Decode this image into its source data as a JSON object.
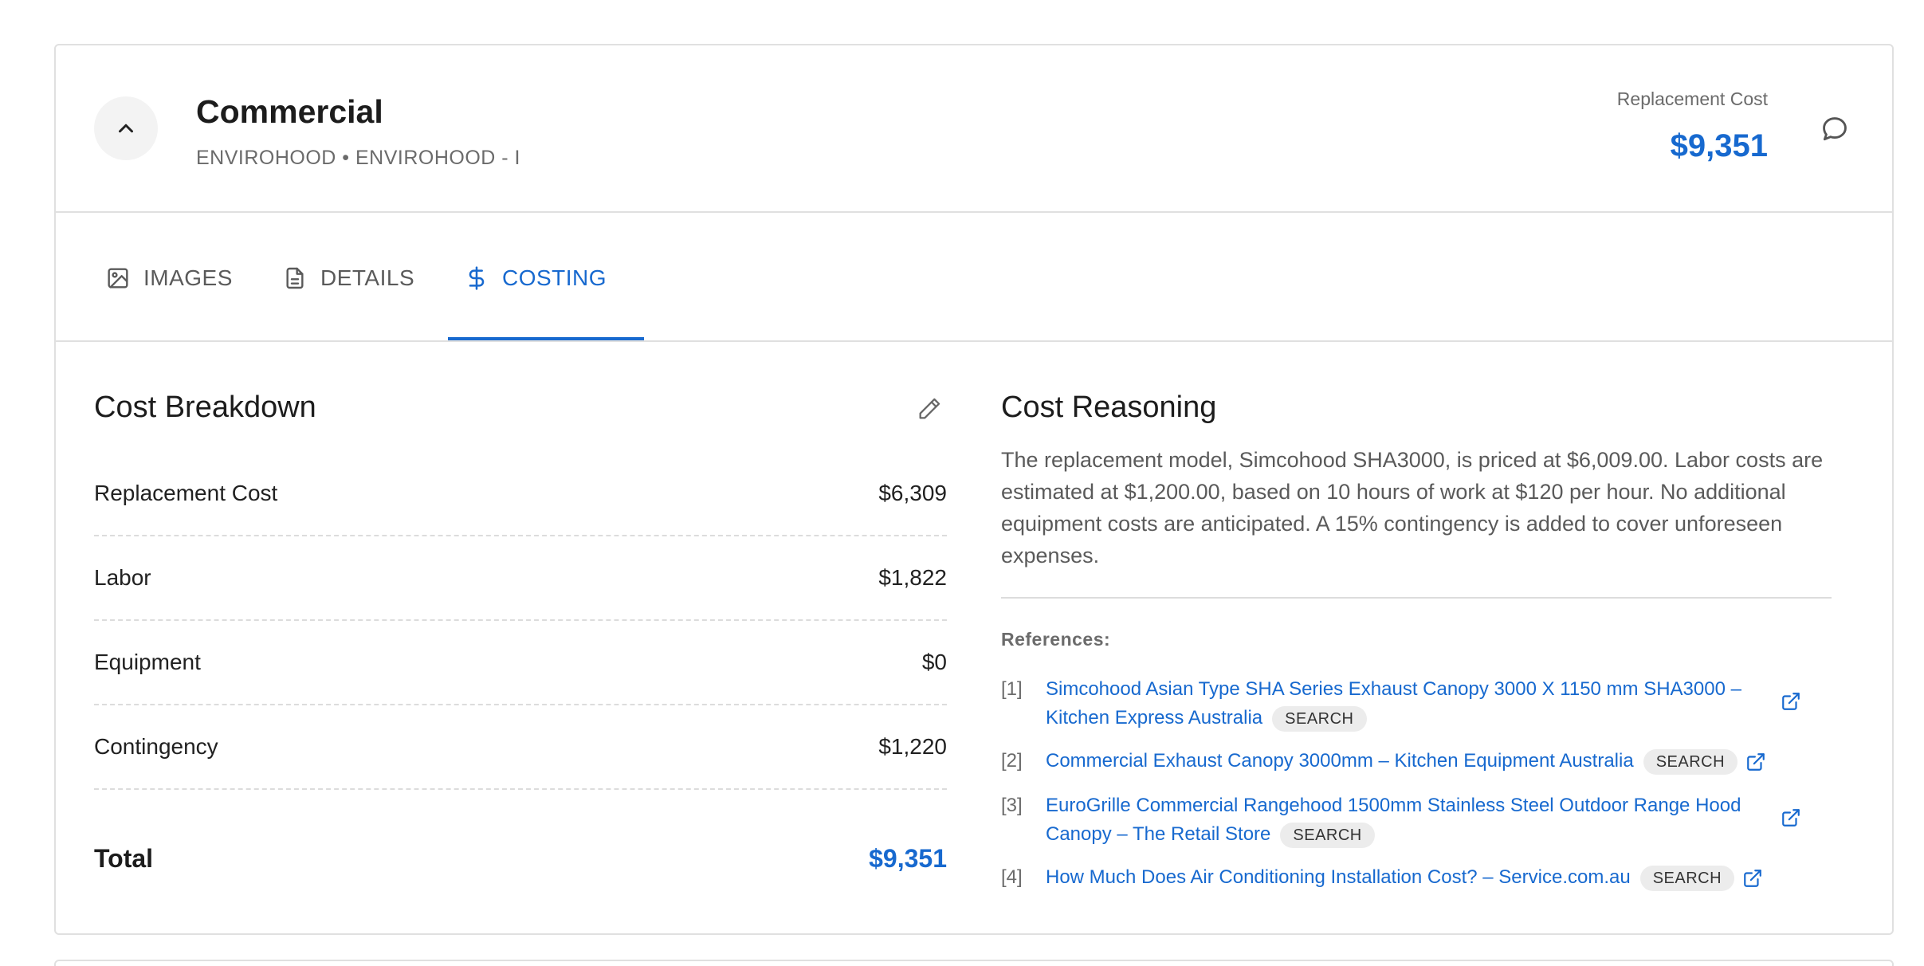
{
  "header": {
    "title": "Commercial",
    "subtitle": "ENVIROHOOD • ENVIROHOOD - I",
    "replacement_label": "Replacement Cost",
    "replacement_value": "$9,351",
    "collapse_icon": "chevron-up-icon",
    "comment_icon": "comment-icon"
  },
  "tabs": [
    {
      "label": "IMAGES",
      "icon": "image-icon",
      "active": false
    },
    {
      "label": "DETAILS",
      "icon": "document-icon",
      "active": false
    },
    {
      "label": "COSTING",
      "icon": "dollar-icon",
      "active": true
    }
  ],
  "breakdown": {
    "title": "Cost Breakdown",
    "rows": [
      {
        "label": "Replacement Cost",
        "value": "$6,309"
      },
      {
        "label": "Labor",
        "value": "$1,822"
      },
      {
        "label": "Equipment",
        "value": "$0"
      },
      {
        "label": "Contingency",
        "value": "$1,220"
      }
    ],
    "total_label": "Total",
    "total_value": "$9,351"
  },
  "reasoning": {
    "title": "Cost Reasoning",
    "text": "The replacement model, Simcohood SHA3000, is priced at $6,009.00. Labor costs are estimated at $1,200.00, based on 10 hours of work at $120 per hour. No additional equipment costs are anticipated. A 15% contingency is added to cover unforeseen expenses.",
    "references_label": "References:",
    "references": [
      {
        "num": "[1]",
        "text": "Simcohood Asian Type SHA Series Exhaust Canopy 3000 X 1150 mm SHA3000 – Kitchen Express Australia",
        "badge": "SEARCH"
      },
      {
        "num": "[2]",
        "text": "Commercial Exhaust Canopy 3000mm – Kitchen Equipment Australia",
        "badge": "SEARCH"
      },
      {
        "num": "[3]",
        "text": "EuroGrille Commercial Rangehood 1500mm Stainless Steel Outdoor Range Hood Canopy – The Retail Store",
        "badge": "SEARCH"
      },
      {
        "num": "[4]",
        "text": "How Much Does Air Conditioning Installation Cost? – Service.com.au",
        "badge": "SEARCH"
      }
    ]
  },
  "colors": {
    "accent": "#1769cf",
    "muted": "#6b6b6b",
    "border": "#e0e0e0"
  }
}
